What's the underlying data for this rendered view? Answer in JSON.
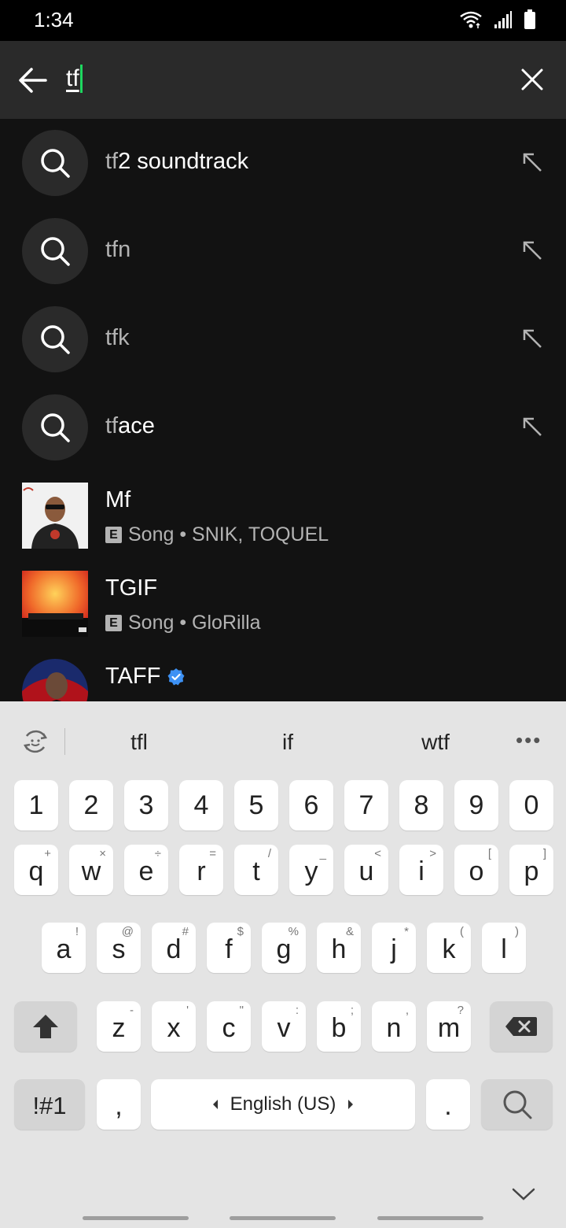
{
  "status_bar": {
    "time": "1:34"
  },
  "search": {
    "query": "tf"
  },
  "suggestions": [
    {
      "prefix": "tf",
      "rest": "2 soundtrack"
    },
    {
      "prefix": "tf",
      "rest": "n"
    },
    {
      "prefix": "tf",
      "rest": "k"
    },
    {
      "prefix": "tf",
      "rest": "ace"
    }
  ],
  "results": [
    {
      "title": "Mf",
      "explicit": "E",
      "subtitle": "Song • SNIK, TOQUEL"
    },
    {
      "title": "TGIF",
      "explicit": "E",
      "subtitle": "Song • GloRilla"
    },
    {
      "title": "TAFF",
      "verified": true
    }
  ],
  "keyboard": {
    "suggestions": [
      "tfl",
      "if",
      "wtf"
    ],
    "number_row": [
      "1",
      "2",
      "3",
      "4",
      "5",
      "6",
      "7",
      "8",
      "9",
      "0"
    ],
    "row1": [
      {
        "k": "q",
        "h": "+"
      },
      {
        "k": "w",
        "h": "×"
      },
      {
        "k": "e",
        "h": "÷"
      },
      {
        "k": "r",
        "h": "="
      },
      {
        "k": "t",
        "h": "/"
      },
      {
        "k": "y",
        "h": "_"
      },
      {
        "k": "u",
        "h": "<"
      },
      {
        "k": "i",
        "h": ">"
      },
      {
        "k": "o",
        "h": "["
      },
      {
        "k": "p",
        "h": "]"
      }
    ],
    "row2": [
      {
        "k": "a",
        "h": "!"
      },
      {
        "k": "s",
        "h": "@"
      },
      {
        "k": "d",
        "h": "#"
      },
      {
        "k": "f",
        "h": "$"
      },
      {
        "k": "g",
        "h": "%"
      },
      {
        "k": "h",
        "h": "&"
      },
      {
        "k": "j",
        "h": "*"
      },
      {
        "k": "k",
        "h": "("
      },
      {
        "k": "l",
        "h": ")"
      }
    ],
    "row3": [
      {
        "k": "z",
        "h": "-"
      },
      {
        "k": "x",
        "h": "'"
      },
      {
        "k": "c",
        "h": "\""
      },
      {
        "k": "v",
        "h": ":"
      },
      {
        "k": "b",
        "h": ";"
      },
      {
        "k": "n",
        "h": ","
      },
      {
        "k": "m",
        "h": "?"
      }
    ],
    "symbols_label": "!#1",
    "comma": ",",
    "space_label": "English (US)",
    "period": "."
  }
}
